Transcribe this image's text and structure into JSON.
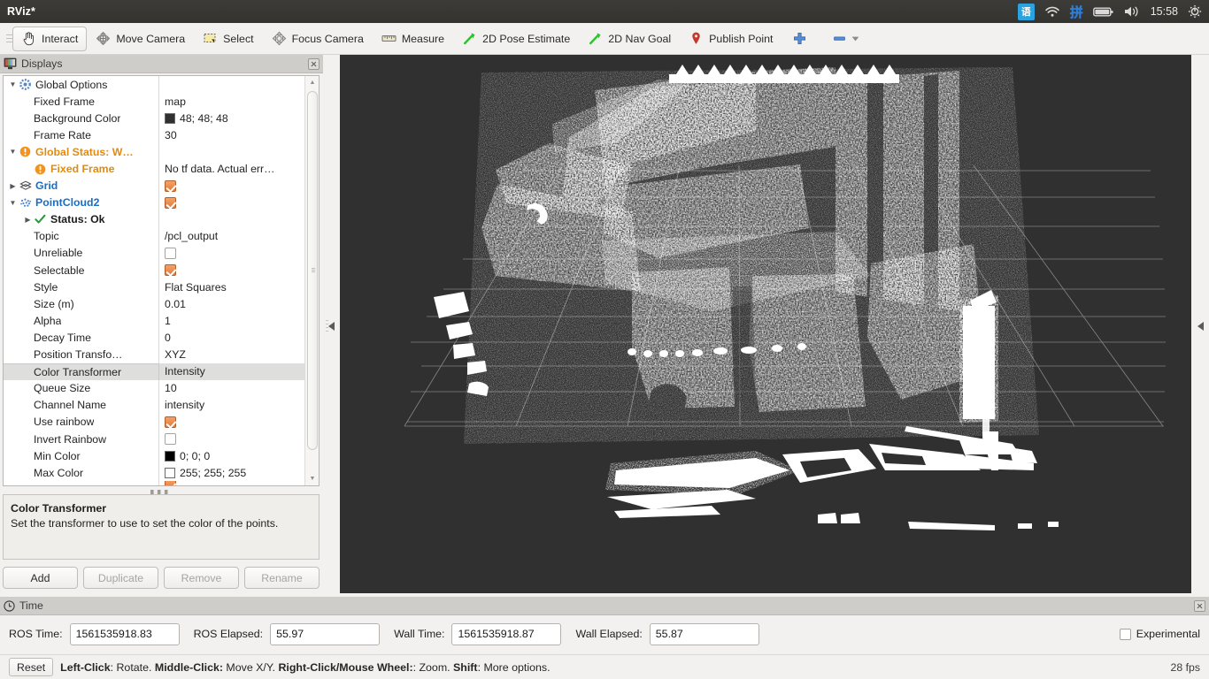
{
  "titlebar": {
    "app_title": "RViz*",
    "tray": {
      "ime_label": "语",
      "wifi_icon": "wifi-icon",
      "pinyin_label": "拼",
      "battery_icon": "battery-icon",
      "volume_icon": "volume-icon",
      "clock": "15:58",
      "power_icon": "power-gear-icon"
    }
  },
  "toolbar": {
    "items": [
      {
        "label": "Interact",
        "icon": "hand-cursor-icon",
        "active": true
      },
      {
        "label": "Move Camera",
        "icon": "move-camera-icon",
        "active": false
      },
      {
        "label": "Select",
        "icon": "select-rectangle-icon",
        "active": false
      },
      {
        "label": "Focus Camera",
        "icon": "focus-camera-icon",
        "active": false
      },
      {
        "label": "Measure",
        "icon": "ruler-icon",
        "active": false
      },
      {
        "label": "2D Pose Estimate",
        "icon": "green-arrow-icon",
        "active": false
      },
      {
        "label": "2D Nav Goal",
        "icon": "green-arrow-icon",
        "active": false
      },
      {
        "label": "Publish Point",
        "icon": "map-pin-icon",
        "active": false
      }
    ],
    "plus_icon": "plus-icon",
    "minus_icon": "minus-icon",
    "overflow_icon": "chevron-down-icon"
  },
  "displays_panel": {
    "title": "Displays",
    "icon": "monitor-icon",
    "close_icon": "close-icon",
    "rows": [
      {
        "indent": 0,
        "arrow": "open",
        "icon": "gear-icon",
        "label": "Global Options",
        "label_style": "plain",
        "value_type": "none",
        "value": ""
      },
      {
        "indent": 1,
        "arrow": "none",
        "icon": "none",
        "label": "Fixed Frame",
        "label_style": "plain",
        "value_type": "text",
        "value": "map"
      },
      {
        "indent": 1,
        "arrow": "none",
        "icon": "none",
        "label": "Background Color",
        "label_style": "plain",
        "value_type": "color",
        "value": "48; 48; 48",
        "swatch": "#303030"
      },
      {
        "indent": 1,
        "arrow": "none",
        "icon": "none",
        "label": "Frame Rate",
        "label_style": "plain",
        "value_type": "text",
        "value": "30"
      },
      {
        "indent": 0,
        "arrow": "open",
        "icon": "warn-icon",
        "label": "Global Status: W…",
        "label_style": "orange",
        "value_type": "none",
        "value": ""
      },
      {
        "indent": 1,
        "arrow": "none",
        "icon": "warn-icon",
        "label": "Fixed Frame",
        "label_style": "orange",
        "value_type": "text",
        "value": "No tf data.  Actual err…"
      },
      {
        "indent": 0,
        "arrow": "closed",
        "icon": "grid-icon",
        "label": "Grid",
        "label_style": "blue",
        "value_type": "check",
        "value": "checked"
      },
      {
        "indent": 0,
        "arrow": "open",
        "icon": "cloud-icon",
        "label": "PointCloud2",
        "label_style": "blue",
        "value_type": "check",
        "value": "checked"
      },
      {
        "indent": 1,
        "arrow": "closed",
        "icon": "ok-icon",
        "label": "Status: Ok",
        "label_style": "greenok",
        "value_type": "none",
        "value": ""
      },
      {
        "indent": 1,
        "arrow": "none",
        "icon": "none",
        "label": "Topic",
        "label_style": "plain",
        "value_type": "text",
        "value": "/pcl_output"
      },
      {
        "indent": 1,
        "arrow": "none",
        "icon": "none",
        "label": "Unreliable",
        "label_style": "plain",
        "value_type": "check",
        "value": "unchecked"
      },
      {
        "indent": 1,
        "arrow": "none",
        "icon": "none",
        "label": "Selectable",
        "label_style": "plain",
        "value_type": "check",
        "value": "checked"
      },
      {
        "indent": 1,
        "arrow": "none",
        "icon": "none",
        "label": "Style",
        "label_style": "plain",
        "value_type": "text",
        "value": "Flat Squares"
      },
      {
        "indent": 1,
        "arrow": "none",
        "icon": "none",
        "label": "Size (m)",
        "label_style": "plain",
        "value_type": "text",
        "value": "0.01"
      },
      {
        "indent": 1,
        "arrow": "none",
        "icon": "none",
        "label": "Alpha",
        "label_style": "plain",
        "value_type": "text",
        "value": "1"
      },
      {
        "indent": 1,
        "arrow": "none",
        "icon": "none",
        "label": "Decay Time",
        "label_style": "plain",
        "value_type": "text",
        "value": "0"
      },
      {
        "indent": 1,
        "arrow": "none",
        "icon": "none",
        "label": "Position Transfo…",
        "label_style": "plain",
        "value_type": "text",
        "value": "XYZ"
      },
      {
        "indent": 1,
        "arrow": "none",
        "icon": "none",
        "label": "Color Transformer",
        "label_style": "plain",
        "value_type": "text",
        "value": "Intensity",
        "selected": true
      },
      {
        "indent": 1,
        "arrow": "none",
        "icon": "none",
        "label": "Queue Size",
        "label_style": "plain",
        "value_type": "text",
        "value": "10"
      },
      {
        "indent": 1,
        "arrow": "none",
        "icon": "none",
        "label": "Channel Name",
        "label_style": "plain",
        "value_type": "text",
        "value": "intensity"
      },
      {
        "indent": 1,
        "arrow": "none",
        "icon": "none",
        "label": "Use rainbow",
        "label_style": "plain",
        "value_type": "check",
        "value": "checked"
      },
      {
        "indent": 1,
        "arrow": "none",
        "icon": "none",
        "label": "Invert Rainbow",
        "label_style": "plain",
        "value_type": "check",
        "value": "unchecked"
      },
      {
        "indent": 1,
        "arrow": "none",
        "icon": "none",
        "label": "Min Color",
        "label_style": "plain",
        "value_type": "color",
        "value": "0; 0; 0",
        "swatch": "#000000"
      },
      {
        "indent": 1,
        "arrow": "none",
        "icon": "none",
        "label": "Max Color",
        "label_style": "plain",
        "value_type": "color",
        "value": "255; 255; 255",
        "swatch": "#ffffff"
      }
    ],
    "description": {
      "title": "Color Transformer",
      "body": "Set the transformer to use to set the color of the points."
    },
    "buttons": [
      {
        "label": "Add",
        "enabled": true
      },
      {
        "label": "Duplicate",
        "enabled": false
      },
      {
        "label": "Remove",
        "enabled": false
      },
      {
        "label": "Rename",
        "enabled": false
      }
    ]
  },
  "viewport": {
    "background_color": "#303030",
    "grid_color": "#9a9a9a",
    "point_color": "#ffffff"
  },
  "time_panel": {
    "title": "Time",
    "icon": "clock-icon",
    "close_icon": "close-icon",
    "fields": [
      {
        "label": "ROS Time:",
        "value": "1561535918.83"
      },
      {
        "label": "ROS Elapsed:",
        "value": "55.97"
      },
      {
        "label": "Wall Time:",
        "value": "1561535918.87"
      },
      {
        "label": "Wall Elapsed:",
        "value": "55.87"
      }
    ],
    "experimental": {
      "label": "Experimental",
      "checked": false
    }
  },
  "statusbar": {
    "reset_label": "Reset",
    "hint_parts": [
      {
        "text": "Left-Click",
        "bold": true
      },
      {
        "text": ": Rotate. ",
        "bold": false
      },
      {
        "text": "Middle-Click:",
        "bold": true
      },
      {
        "text": " Move X/Y. ",
        "bold": false
      },
      {
        "text": "Right-Click/Mouse Wheel:",
        "bold": true
      },
      {
        "text": ": Zoom. ",
        "bold": false
      },
      {
        "text": "Shift",
        "bold": true
      },
      {
        "text": ": More options.",
        "bold": false
      }
    ],
    "fps": "28 fps"
  }
}
